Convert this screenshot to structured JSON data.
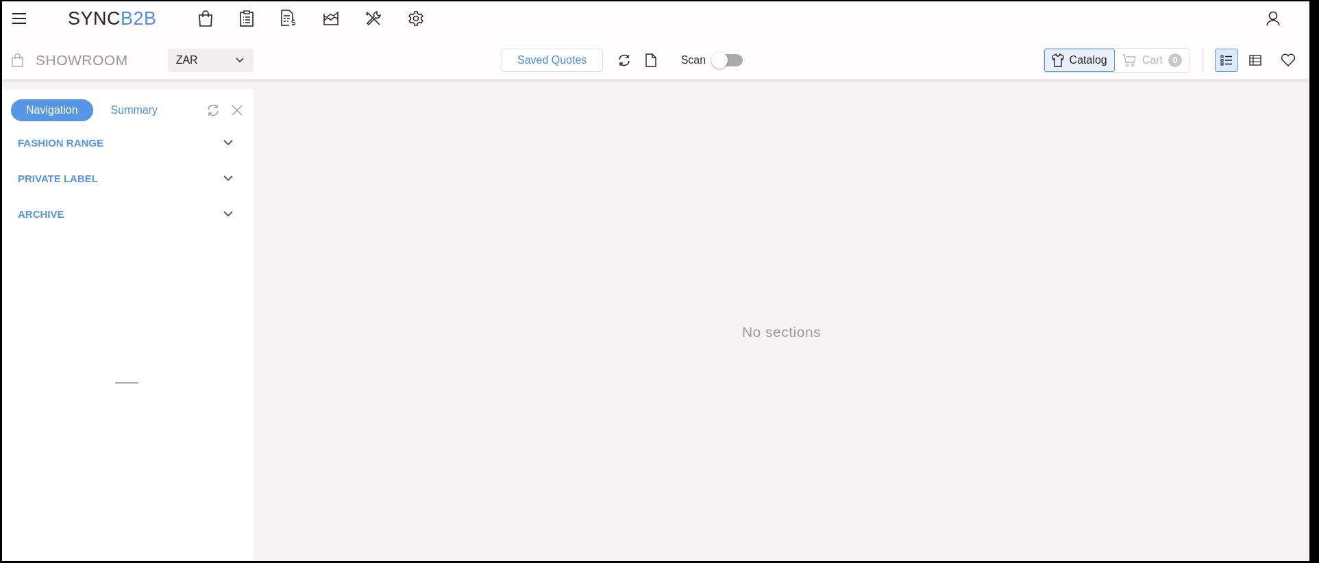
{
  "header": {
    "logo": {
      "text": "SYNC",
      "accent": "B2B"
    }
  },
  "toolbar": {
    "title": "SHOWROOM",
    "currency": "ZAR",
    "saved_quotes": "Saved Quotes",
    "scan": {
      "label": "Scan",
      "on": false
    },
    "modes": [
      {
        "kind": "catalog",
        "label": "Catalog",
        "selected": true
      },
      {
        "kind": "cart",
        "label": "Cart",
        "badge": "0",
        "selected": false
      }
    ],
    "views": [
      {
        "kind": "list",
        "selected": true
      },
      {
        "kind": "table",
        "selected": false
      }
    ]
  },
  "sidebar": {
    "tabs": [
      {
        "label": "Navigation",
        "selected": true
      },
      {
        "label": "Summary",
        "selected": false
      }
    ],
    "sections": [
      {
        "label": "FASHION RANGE",
        "expanded": false
      },
      {
        "label": "PRIVATE LABEL",
        "expanded": false
      },
      {
        "label": "ARCHIVE",
        "expanded": false
      }
    ]
  },
  "main": {
    "empty_message": "No sections"
  }
}
